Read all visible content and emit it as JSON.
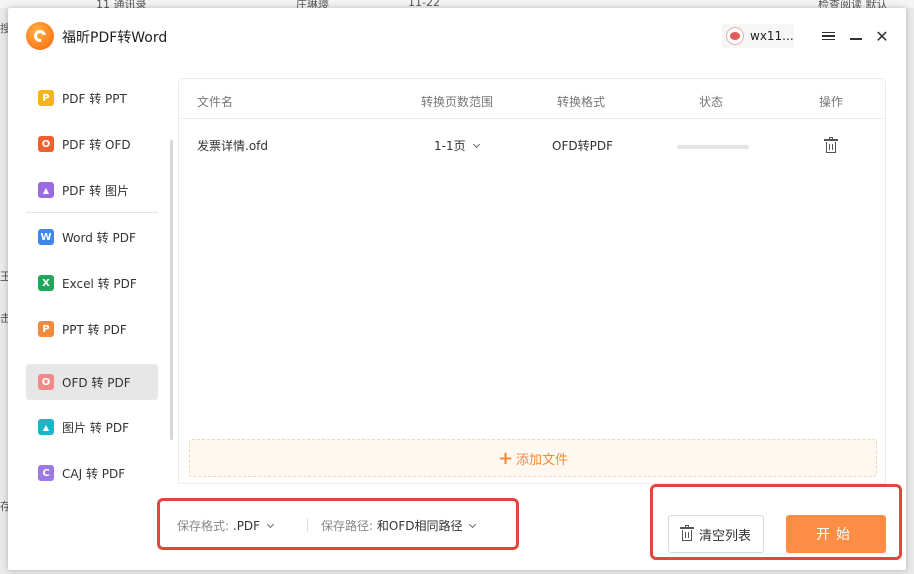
{
  "background": {
    "top_left_text": "11  通讯录",
    "top_name": "庄琳璎",
    "top_time": "11-22",
    "right_text": "检查阅读 默认",
    "left_fragments": [
      "搜",
      "王",
      "击",
      "存"
    ]
  },
  "app": {
    "title": "福昕PDF转Word",
    "user_name": "wx11...",
    "accent_color": "#fb8e44"
  },
  "window_controls": {
    "menu_icon": "menu-icon",
    "minimize_icon": "minimize-icon",
    "close_icon": "close-icon",
    "close_label": "✕"
  },
  "sidebar": {
    "items": [
      {
        "label": "PDF 转 PPT",
        "icon_text": "P",
        "icon_color": "#f5b419",
        "icon": "ppt-icon"
      },
      {
        "label": "PDF 转 OFD",
        "icon_text": "O",
        "icon_color": "#f0612e",
        "icon": "ofd-icon"
      },
      {
        "label": "PDF 转 图片",
        "icon_text": "▲",
        "icon_color": "#9b6bdf",
        "icon": "image-icon"
      },
      {
        "label": "Word 转 PDF",
        "icon_text": "W",
        "icon_color": "#3f87e8",
        "icon": "word-icon"
      },
      {
        "label": "Excel 转 PDF",
        "icon_text": "X",
        "icon_color": "#20a75b",
        "icon": "excel-icon"
      },
      {
        "label": "PPT 转 PDF",
        "icon_text": "P",
        "icon_color": "#f28a3c",
        "icon": "ppt-icon"
      },
      {
        "label": "OFD 转 PDF",
        "icon_text": "O",
        "icon_color": "#f28a8a",
        "icon": "ofd-icon",
        "active": true
      },
      {
        "label": "图片 转 PDF",
        "icon_text": "▲",
        "icon_color": "#1cb5c8",
        "icon": "image-icon"
      },
      {
        "label": "CAJ 转 PDF",
        "icon_text": "C",
        "icon_color": "#9c79e3",
        "icon": "caj-icon"
      }
    ]
  },
  "table": {
    "headers": {
      "filename": "文件名",
      "page_range": "转换页数范围",
      "format": "转换格式",
      "status": "状态",
      "actions": "操作"
    },
    "rows": [
      {
        "filename": "发票详情.ofd",
        "page_range": "1-1页",
        "format": "OFD转PDF",
        "progress": 0
      }
    ]
  },
  "add_file": {
    "icon": "+",
    "label": "添加文件"
  },
  "save": {
    "format_label": "保存格式:",
    "format_value": ".PDF",
    "path_label": "保存路径:",
    "path_value": "和OFD相同路径"
  },
  "actions": {
    "clear_label": "清空列表",
    "start_label": "开始"
  }
}
